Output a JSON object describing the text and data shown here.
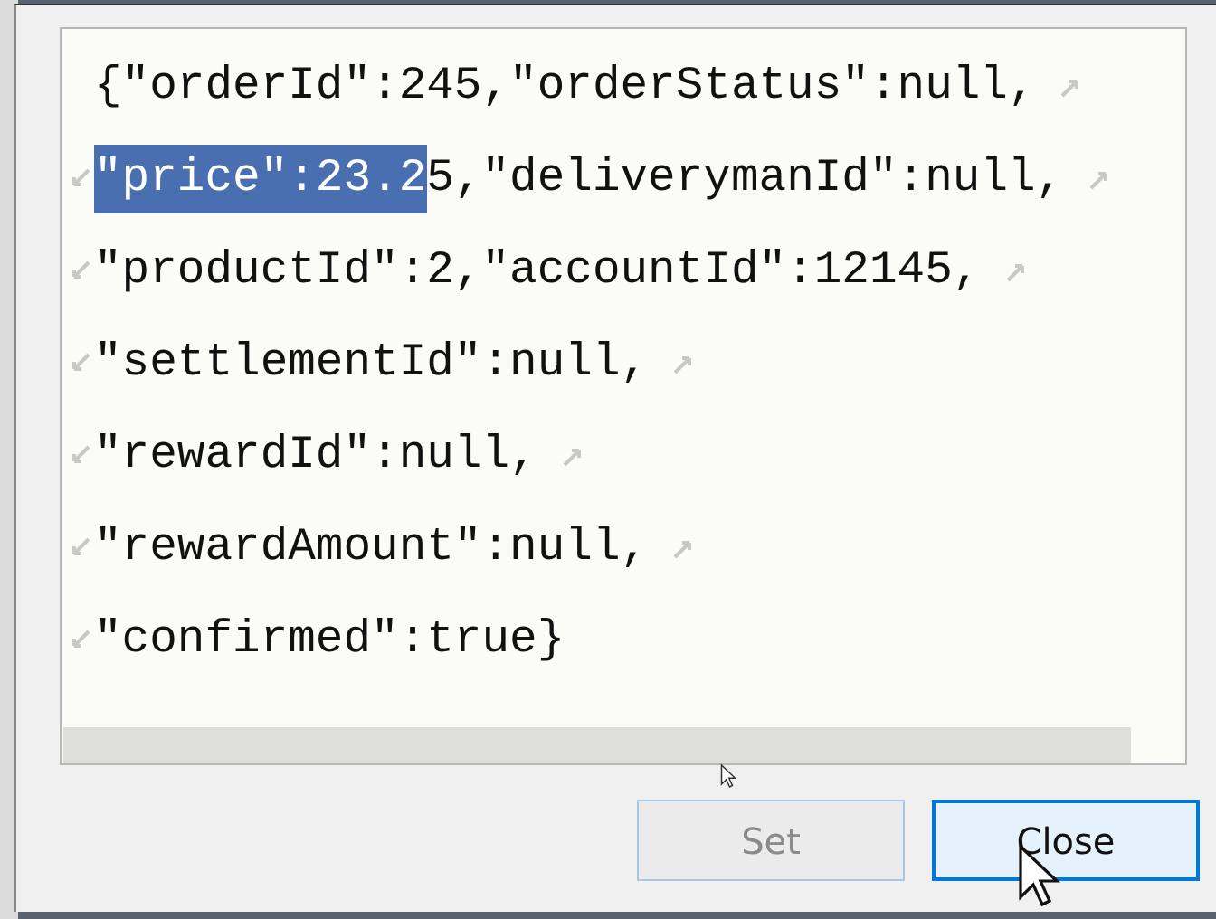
{
  "editor": {
    "lines": [
      {
        "wrap_in": false,
        "wrap_out": true,
        "segments": [
          {
            "text": "{\"orderId\":245,\"orderStatus\":null,",
            "selected": false
          }
        ]
      },
      {
        "wrap_in": true,
        "wrap_out": true,
        "segments": [
          {
            "text": "\"price\":23.2",
            "selected": true
          },
          {
            "text": "5,\"deliverymanId\":null,",
            "selected": false
          }
        ]
      },
      {
        "wrap_in": true,
        "wrap_out": true,
        "segments": [
          {
            "text": "\"productId\":2,\"accountId\":12145,",
            "selected": false
          }
        ]
      },
      {
        "wrap_in": true,
        "wrap_out": true,
        "segments": [
          {
            "text": "\"settlementId\":null,",
            "selected": false
          }
        ]
      },
      {
        "wrap_in": true,
        "wrap_out": true,
        "segments": [
          {
            "text": "\"rewardId\":null,",
            "selected": false
          }
        ]
      },
      {
        "wrap_in": true,
        "wrap_out": true,
        "segments": [
          {
            "text": "\"rewardAmount\":null,",
            "selected": false
          }
        ]
      },
      {
        "wrap_in": true,
        "wrap_out": false,
        "segments": [
          {
            "text": "\"confirmed\":true}",
            "selected": false
          }
        ]
      }
    ]
  },
  "buttons": [
    {
      "label": "Set",
      "disabled": true,
      "focused": false
    },
    {
      "label": "Close",
      "disabled": false,
      "focused": true
    }
  ]
}
